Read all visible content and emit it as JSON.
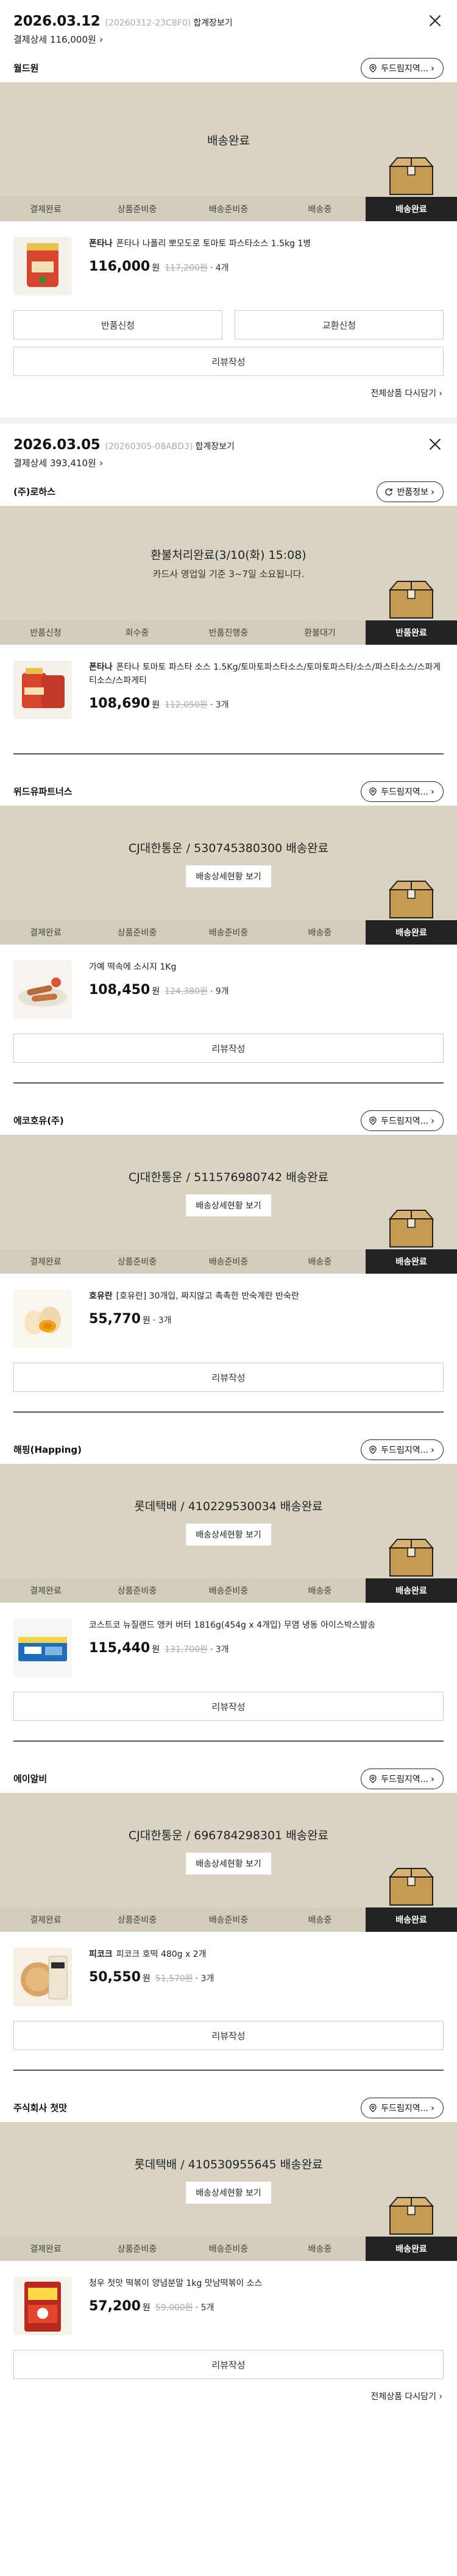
{
  "orders": [
    {
      "date": "2026.03.12",
      "order_no": "(20260312-23C8F0)",
      "detail_link": "합계장보기",
      "pay_text": "결제상세 116,000원",
      "sellers": [
        {
          "name": "월드원",
          "action": "두드림지역...",
          "tracker_title": "배송완료",
          "tracker_sub": "",
          "track_btn": "",
          "steps": [
            "결제완료",
            "상품준비중",
            "배송준비중",
            "배송중",
            "배송완료"
          ],
          "product": {
            "brand": "폰타나",
            "name": "폰타나 나폴리 뽀모도로 토마토 파스타소스 1.5kg 1병",
            "price": "116,000",
            "won": "원",
            "was": "117,200원",
            "qty": "· 4개"
          },
          "buttons_row": [
            "반품신청",
            "교환신청"
          ],
          "button_full": "리뷰작성",
          "reorder": "전체상품 다시담기 ›"
        }
      ]
    },
    {
      "date": "2026.03.05",
      "order_no": "(20260305-08ABD3)",
      "detail_link": "합계장보기",
      "pay_text": "결제상세 393,410원",
      "sellers": [
        {
          "name": "(주)로하스",
          "action": "반품정보",
          "tracker_title": "환불처리완료(3/10(화) 15:08)",
          "tracker_sub": "카드사 영업일 기준 3~7일 소요됩니다.",
          "track_btn": "",
          "steps": [
            "반품신청",
            "회수중",
            "반품진행중",
            "환불대기",
            "반품완료"
          ],
          "product": {
            "brand": "폰타나",
            "name": "폰타나 토마토 파스타 소스 1.5Kg/토마토파스타소스/토마토파스타/소스/파스타소스/스파게티소스/스파게티",
            "price": "108,690",
            "won": "원",
            "was": "112,050원",
            "qty": "· 3개"
          }
        },
        {
          "name": "위드유파트너스",
          "action": "두드림지역...",
          "tracker_title": "CJ대한통운 / 530745380300 배송완료",
          "tracker_sub": "",
          "track_btn": "배송상세현황 보기",
          "steps": [
            "결제완료",
            "상품준비중",
            "배송준비중",
            "배송중",
            "배송완료"
          ],
          "product": {
            "brand": "",
            "name": "가예 떡속에 소시지 1Kg",
            "price": "108,450",
            "won": "원",
            "was": "124,380원",
            "qty": "· 9개"
          },
          "button_full": "리뷰작성"
        },
        {
          "name": "에코호유(주)",
          "action": "두드림지역...",
          "tracker_title": "CJ대한통운 / 511576980742 배송완료",
          "tracker_sub": "",
          "track_btn": "배송상세현황 보기",
          "steps": [
            "결제완료",
            "상품준비중",
            "배송준비중",
            "배송중",
            "배송완료"
          ],
          "product": {
            "brand": "호유란",
            "name": "[호유란] 30개입, 짜지않고 촉촉한 반숙계란 반숙란",
            "price": "55,770",
            "won": "원",
            "was": "",
            "qty": "· 3개"
          },
          "button_full": "리뷰작성"
        },
        {
          "name": "해핑(Happing)",
          "action": "두드림지역...",
          "tracker_title": "롯데택배 / 410229530034 배송완료",
          "tracker_sub": "",
          "track_btn": "배송상세현황 보기",
          "steps": [
            "결제완료",
            "상품준비중",
            "배송준비중",
            "배송중",
            "배송완료"
          ],
          "product": {
            "brand": "",
            "name": "코스트코 뉴질랜드 앵커 버터 1816g(454g x 4개입) 무염 냉동 아이스박스발송",
            "price": "115,440",
            "won": "원",
            "was": "131,700원",
            "qty": "· 3개"
          },
          "button_full": "리뷰작성"
        },
        {
          "name": "에이알비",
          "action": "두드림지역...",
          "tracker_title": "CJ대한통운 / 696784298301 배송완료",
          "tracker_sub": "",
          "track_btn": "배송상세현황 보기",
          "steps": [
            "결제완료",
            "상품준비중",
            "배송준비중",
            "배송중",
            "배송완료"
          ],
          "product": {
            "brand": "피코크",
            "name": "피코크 호떡 480g x 2개",
            "price": "50,550",
            "won": "원",
            "was": "51,570원",
            "qty": "· 3개"
          },
          "button_full": "리뷰작성"
        },
        {
          "name": "주식회사 첫맛",
          "action": "두드림지역...",
          "tracker_title": "롯데택배 / 410530955645 배송완료",
          "tracker_sub": "",
          "track_btn": "배송상세현황 보기",
          "steps": [
            "결제완료",
            "상품준비중",
            "배송준비중",
            "배송중",
            "배송완료"
          ],
          "product": {
            "brand": "",
            "name": "청우 첫맛 떡볶이 양념분말 1kg 맛남떡볶이 소스",
            "price": "57,200",
            "won": "원",
            "was": "59,000원",
            "qty": "· 5개"
          },
          "button_full": "리뷰작성",
          "reorder": "전체상품 다시담기 ›"
        }
      ]
    }
  ]
}
